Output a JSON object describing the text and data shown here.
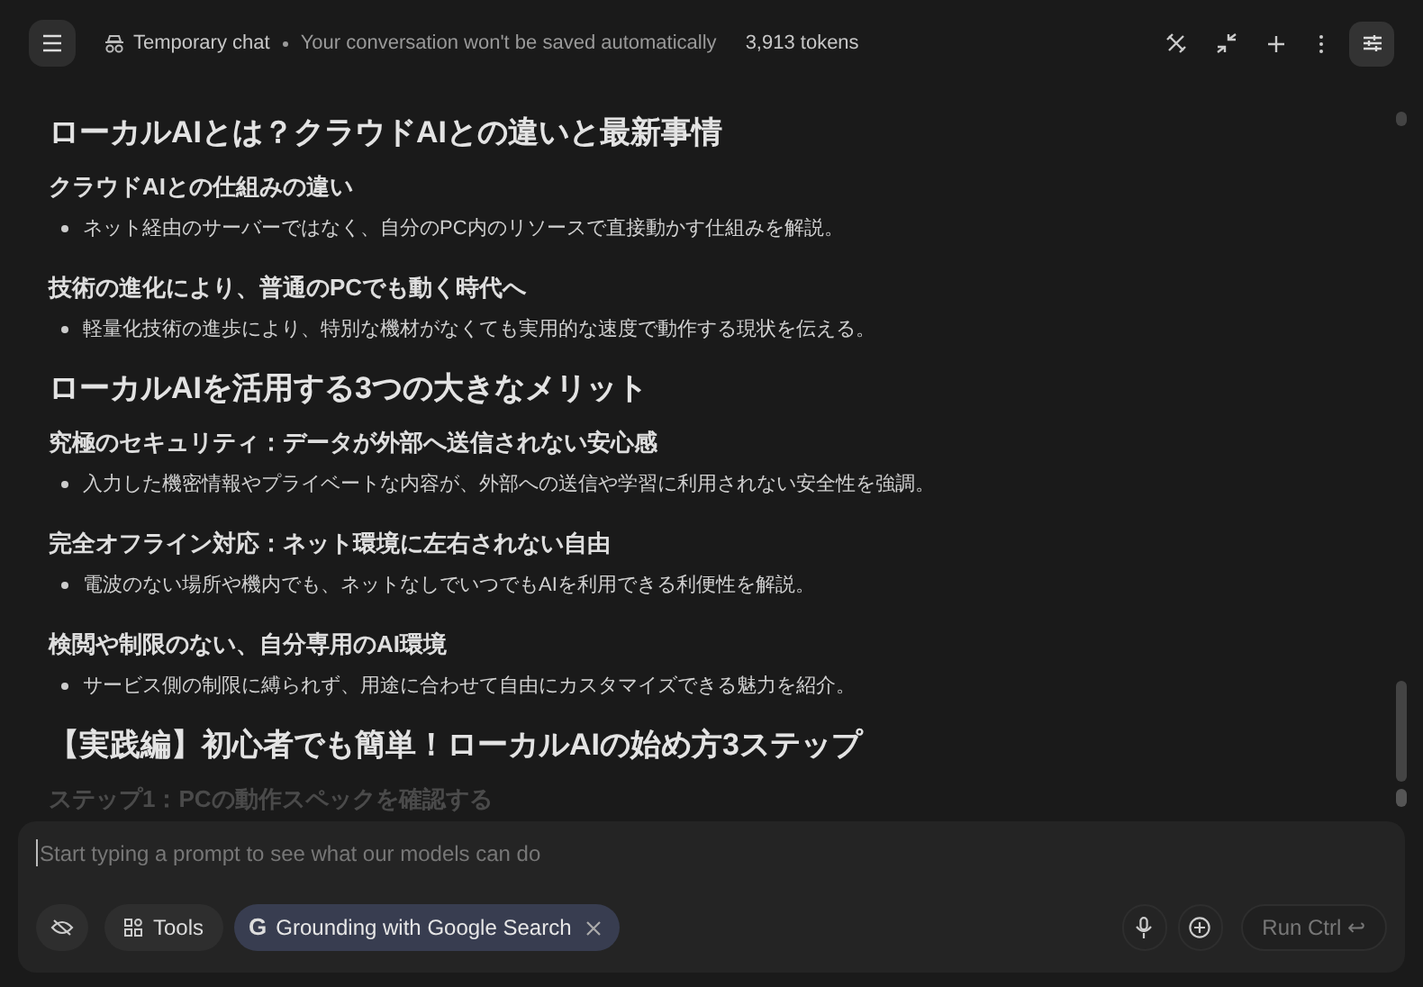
{
  "header": {
    "title": "Temporary chat",
    "subtitle": "Your conversation won't be saved automatically",
    "tokens": "3,913 tokens"
  },
  "content": [
    {
      "kind": "h1",
      "text": "ローカルAIとは？クラウドAIとの違いと最新事情"
    },
    {
      "kind": "h2",
      "text": "クラウドAIとの仕組みの違い"
    },
    {
      "kind": "bullet",
      "text": "ネット経由のサーバーではなく、自分のPC内のリソースで直接動かす仕組みを解説。"
    },
    {
      "kind": "h2",
      "text": "技術の進化により、普通のPCでも動く時代へ"
    },
    {
      "kind": "bullet",
      "text": "軽量化技術の進歩により、特別な機材がなくても実用的な速度で動作する現状を伝える。"
    },
    {
      "kind": "h1",
      "text": "ローカルAIを活用する3つの大きなメリット"
    },
    {
      "kind": "h2",
      "text": "究極のセキュリティ：データが外部へ送信されない安心感"
    },
    {
      "kind": "bullet",
      "text": "入力した機密情報やプライベートな内容が、外部への送信や学習に利用されない安全性を強調。"
    },
    {
      "kind": "h2",
      "text": "完全オフライン対応：ネット環境に左右されない自由"
    },
    {
      "kind": "bullet",
      "text": "電波のない場所や機内でも、ネットなしでいつでもAIを利用できる利便性を解説。"
    },
    {
      "kind": "h2",
      "text": "検閲や制限のない、自分専用のAI環境"
    },
    {
      "kind": "bullet",
      "text": "サービス側の制限に縛られず、用途に合わせて自由にカスタマイズできる魅力を紹介。"
    },
    {
      "kind": "h1",
      "text": "【実践編】初心者でも簡単！ローカルAIの始め方3ステップ"
    },
    {
      "kind": "h2",
      "text": "ステップ1：PCの動作スペックを確認する",
      "faded": true
    }
  ],
  "composer": {
    "placeholder": "Start typing a prompt to see what our models can do",
    "tools_label": "Tools",
    "grounding_chip": "Grounding with Google Search",
    "grounding_g": "G",
    "run_label": "Run Ctrl ↩"
  }
}
